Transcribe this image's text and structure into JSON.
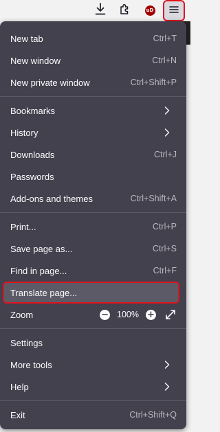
{
  "toolbar": {
    "download_icon": "download-icon",
    "extensions_icon": "extensions-icon",
    "ublock_badge": "uD",
    "menu_icon": "hamburger-icon"
  },
  "menu": {
    "groups": [
      [
        {
          "label": "New tab",
          "shortcut": "Ctrl+T"
        },
        {
          "label": "New window",
          "shortcut": "Ctrl+N"
        },
        {
          "label": "New private window",
          "shortcut": "Ctrl+Shift+P"
        }
      ],
      [
        {
          "label": "Bookmarks",
          "submenu": true
        },
        {
          "label": "History",
          "submenu": true
        },
        {
          "label": "Downloads",
          "shortcut": "Ctrl+J"
        },
        {
          "label": "Passwords"
        },
        {
          "label": "Add-ons and themes",
          "shortcut": "Ctrl+Shift+A"
        }
      ],
      [
        {
          "label": "Print...",
          "shortcut": "Ctrl+P"
        },
        {
          "label": "Save page as...",
          "shortcut": "Ctrl+S"
        },
        {
          "label": "Find in page...",
          "shortcut": "Ctrl+F"
        },
        {
          "label": "Translate page...",
          "highlighted": true
        },
        {
          "label": "Zoom",
          "zoom": true
        }
      ],
      [
        {
          "label": "Settings"
        },
        {
          "label": "More tools",
          "submenu": true
        },
        {
          "label": "Help",
          "submenu": true
        }
      ],
      [
        {
          "label": "Exit",
          "shortcut": "Ctrl+Shift+Q"
        }
      ]
    ]
  },
  "zoom": {
    "minus": "−",
    "value": "100%",
    "plus": "+"
  },
  "colors": {
    "panel_bg": "#42414d",
    "highlight_border": "#e0141f",
    "text": "#fbfbfe",
    "shortcut_text": "#b9b8c0"
  }
}
